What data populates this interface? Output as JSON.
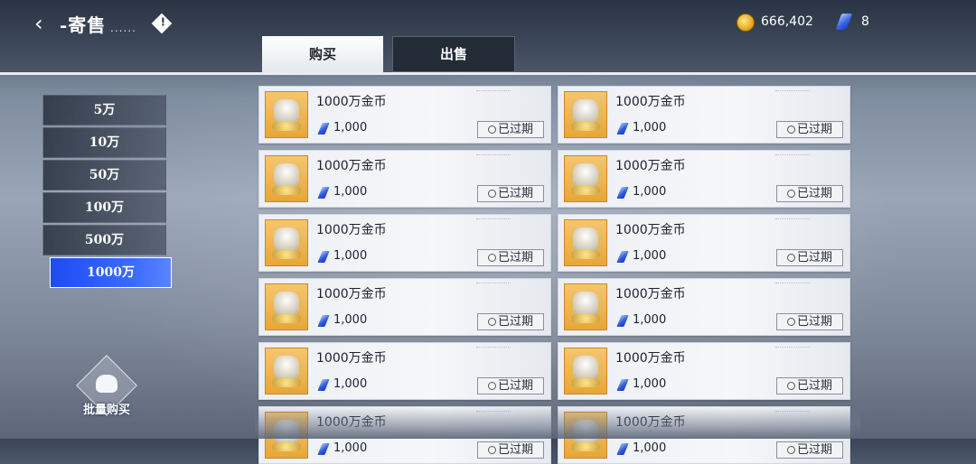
{
  "header": {
    "title": "-寄售",
    "title_suffix": "......",
    "info_icon": "warning-diamond-icon",
    "coins": "666,402",
    "gems": "8"
  },
  "tabs": [
    {
      "label": "购买",
      "active": true
    },
    {
      "label": "出售",
      "active": false
    }
  ],
  "categories": [
    {
      "label": "5万",
      "active": false
    },
    {
      "label": "10万",
      "active": false
    },
    {
      "label": "50万",
      "active": false
    },
    {
      "label": "100万",
      "active": false
    },
    {
      "label": "500万",
      "active": false
    },
    {
      "label": "1000万",
      "active": true
    }
  ],
  "bulk_buy": {
    "label": "批量购买",
    "icon": "hand-coin-icon"
  },
  "listings": [
    {
      "name": "1000万金币",
      "price": "1,000",
      "status": "已过期"
    },
    {
      "name": "1000万金币",
      "price": "1,000",
      "status": "已过期"
    },
    {
      "name": "1000万金币",
      "price": "1,000",
      "status": "已过期"
    },
    {
      "name": "1000万金币",
      "price": "1,000",
      "status": "已过期"
    },
    {
      "name": "1000万金币",
      "price": "1,000",
      "status": "已过期"
    },
    {
      "name": "1000万金币",
      "price": "1,000",
      "status": "已过期"
    },
    {
      "name": "1000万金币",
      "price": "1,000",
      "status": "已过期"
    },
    {
      "name": "1000万金币",
      "price": "1,000",
      "status": "已过期"
    },
    {
      "name": "1000万金币",
      "price": "1,000",
      "status": "已过期"
    },
    {
      "name": "1000万金币",
      "price": "1,000",
      "status": "已过期"
    },
    {
      "name": "1000万金币",
      "price": "1,000",
      "status": "已过期"
    },
    {
      "name": "1000万金币",
      "price": "1,000",
      "status": "已过期"
    }
  ],
  "colors": {
    "accent": "#2f5cf5",
    "coin": "#e0a418",
    "gem": "#3a66e6"
  }
}
